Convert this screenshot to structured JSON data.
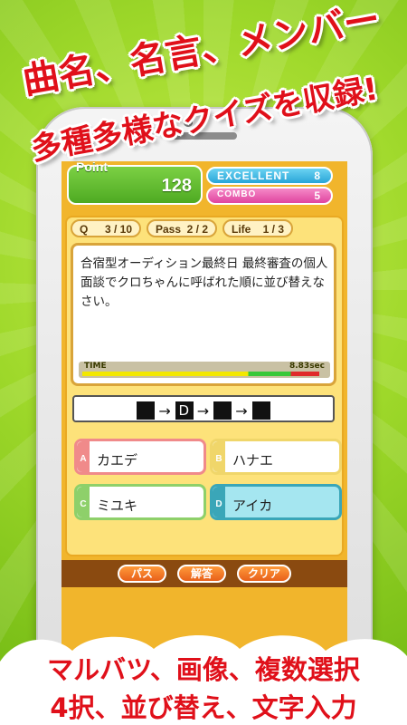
{
  "headline": {
    "line1": "曲名、名言、メンバー",
    "line2": "多種多様なクイズを収録!"
  },
  "score": {
    "label": "Point",
    "value": "128"
  },
  "excellent": {
    "label": "EXCELLENT",
    "value": "8"
  },
  "combo": {
    "label": "COMBO",
    "value": "5"
  },
  "stats": {
    "q": {
      "label": "Q",
      "value": "3 / 10"
    },
    "pass": {
      "label": "Pass",
      "value": "2 / 2"
    },
    "life": {
      "label": "Life",
      "value": "1 / 3"
    }
  },
  "question": {
    "text": "合宿型オーディション最終日 最終審査の個人面談でクロちゃんに呼ばれた順に並び替えなさい。"
  },
  "timer": {
    "label": "TIME",
    "value": "8.83sec",
    "remaining_fraction": 0.97
  },
  "answer_slot": {
    "arrow": "→",
    "filled_letter": "D"
  },
  "choices": [
    {
      "badge": "A",
      "label": "カエデ"
    },
    {
      "badge": "B",
      "label": "ハナエ"
    },
    {
      "badge": "C",
      "label": "ミユキ"
    },
    {
      "badge": "D",
      "label": "アイカ"
    }
  ],
  "buttons": {
    "pass": "パス",
    "answer": "解答",
    "clear": "クリア"
  },
  "footer": {
    "line1": "マルバツ、画像、複数選択",
    "line2": "4択、並び替え、文字入力"
  },
  "colors": {
    "accent_red": "#e0101a",
    "background_green": "#9ed82a",
    "screen_orange": "#f1b52c"
  }
}
